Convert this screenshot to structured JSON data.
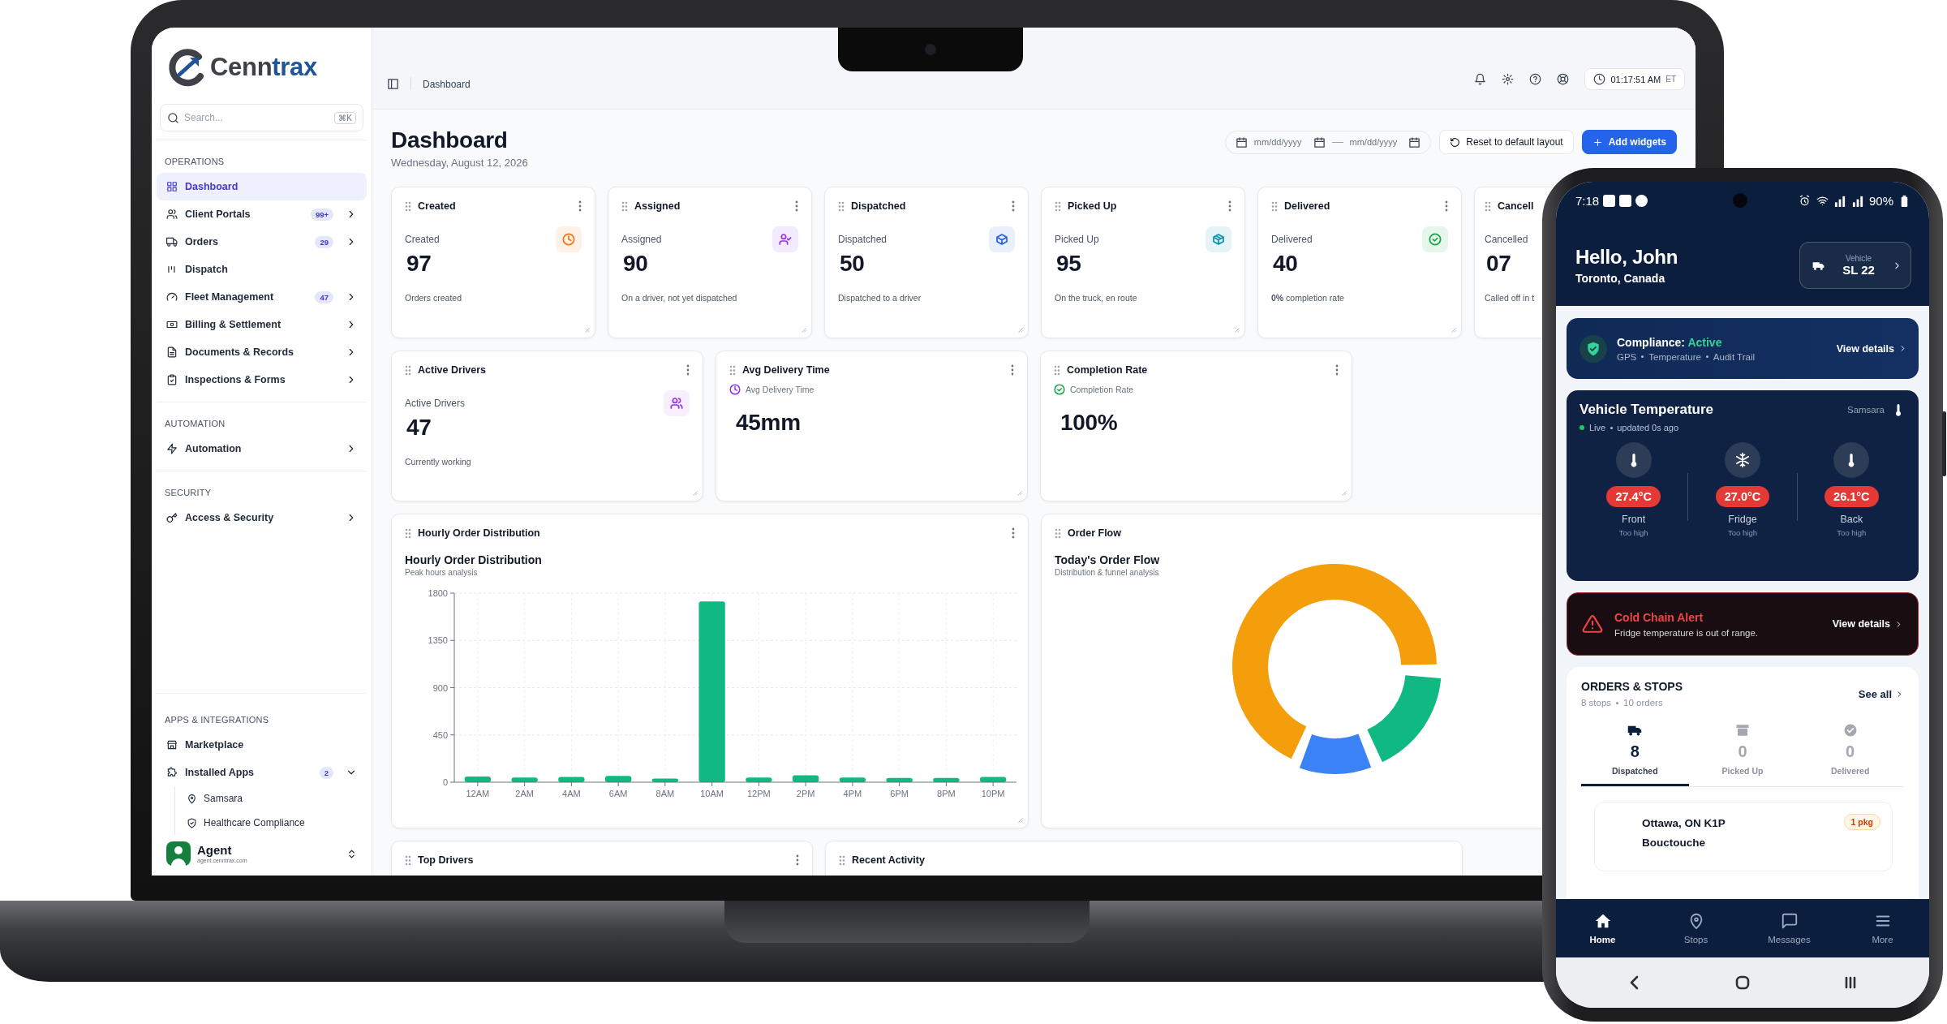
{
  "laptop": {
    "sidebar": {
      "brand": {
        "name": "Cenn",
        "accent": "trax"
      },
      "search": {
        "placeholder": "Search...",
        "shortcut": "⌘K"
      },
      "sections": [
        {
          "title": "OPERATIONS",
          "items": [
            {
              "label": "Dashboard",
              "selected": true,
              "submenu": false
            },
            {
              "label": "Client Portals",
              "badge": "99+",
              "selected": false,
              "submenu": true
            },
            {
              "label": "Orders",
              "badge": "29",
              "selected": false,
              "submenu": true
            },
            {
              "label": "Dispatch",
              "selected": false,
              "submenu": false
            },
            {
              "label": "Fleet Management",
              "badge": "47",
              "selected": false,
              "submenu": true
            },
            {
              "label": "Billing & Settlement",
              "selected": false,
              "submenu": true
            },
            {
              "label": "Documents & Records",
              "selected": false,
              "submenu": true
            },
            {
              "label": "Inspections & Forms",
              "selected": false,
              "submenu": true
            }
          ]
        },
        {
          "title": "AUTOMATION",
          "items": [
            {
              "label": "Automation",
              "selected": false,
              "submenu": true
            }
          ]
        },
        {
          "title": "SECURITY",
          "items": [
            {
              "label": "Access & Security",
              "selected": false,
              "submenu": true
            }
          ]
        }
      ],
      "apps": {
        "title": "APPS & INTEGRATIONS",
        "items": [
          {
            "label": "Marketplace",
            "selected": false,
            "submenu": false
          },
          {
            "label": "Installed Apps",
            "badge": "2",
            "selected": false,
            "submenu": true,
            "expanded": true,
            "children": [
              {
                "label": "Samsara"
              },
              {
                "label": "Healthcare Compliance"
              }
            ]
          }
        ]
      },
      "user": {
        "name": "Agent",
        "email": "agent.cenntrax.com"
      }
    },
    "topbar": {
      "breadcrumb": "Dashboard",
      "clock": "01:17:51 AM",
      "timezone": "ET"
    },
    "page": {
      "title": "Dashboard",
      "date": "Wednesday, August 12, 2026",
      "date_from": {
        "placeholder": "mm/dd/yyyy"
      },
      "date_to": {
        "placeholder": "mm/dd/yyyy"
      },
      "buttons": [
        {
          "label": "Reset to default layout",
          "kind": "secondary"
        },
        {
          "label": "Add widgets",
          "kind": "primary"
        }
      ]
    },
    "stat_cards": [
      {
        "title": "Created",
        "label": "Created",
        "value": "97",
        "caption": "Orders created",
        "color": "#f97316"
      },
      {
        "title": "Assigned",
        "label": "Assigned",
        "value": "90",
        "caption": "On a driver, not yet dispatched",
        "color": "#9333ea"
      },
      {
        "title": "Dispatched",
        "label": "Dispatched",
        "value": "50",
        "caption": "Dispatched to a driver",
        "color": "#2563eb"
      },
      {
        "title": "Picked Up",
        "label": "Picked Up",
        "value": "95",
        "caption": "On the truck, en route",
        "color": "#0891b2"
      },
      {
        "title": "Delivered",
        "label": "Delivered",
        "value": "40",
        "caption": "**0%** completion rate",
        "color": "#16a34a"
      },
      {
        "title": "Cancell",
        "label": "Cancelled",
        "value": "07",
        "caption": "Called off in t"
      }
    ],
    "metric_cards": [
      {
        "title": "Active Drivers",
        "label": "Active Drivers",
        "value": "47",
        "caption": "Currently working",
        "kind": "badge",
        "color": "#9333ea"
      },
      {
        "title": "Avg Delivery Time",
        "label": "Avg Delivery Time",
        "value": "45mm",
        "kind": "inline",
        "color": "#9333ea"
      },
      {
        "title": "Completion Rate",
        "label": "Completion Rate",
        "value": "100%",
        "kind": "inline",
        "color": "#16a34a"
      }
    ],
    "widgets": {
      "hourly": {
        "title": "Hourly Order Distribution",
        "heading": "Hourly Order Distribution",
        "subtitle": "Peak hours analysis",
        "chart_data": {
          "type": "bar",
          "categories": [
            "12AM",
            "2AM",
            "4AM",
            "6AM",
            "8AM",
            "10AM",
            "12PM",
            "2PM",
            "4PM",
            "6PM",
            "8PM",
            "10PM"
          ],
          "values": [
            55,
            45,
            50,
            60,
            35,
            1720,
            45,
            65,
            45,
            40,
            40,
            50
          ],
          "ylim": [
            0,
            1800
          ],
          "yticks": [
            0,
            450,
            900,
            1350,
            1800
          ],
          "grid": true
        }
      },
      "flow": {
        "title": "Order Flow",
        "heading": "Today's Order Flow",
        "subtitle": "Distribution & funnel analysis"
      },
      "more": [
        {
          "title": "Top Drivers"
        },
        {
          "title": "Recent Activity"
        }
      ]
    }
  },
  "phone": {
    "status_bar": {
      "time": "7:18",
      "battery": "90%"
    },
    "greeting": "Hello, John",
    "location": "Toronto, Canada",
    "vehicle": {
      "label": "Vehicle",
      "value": "SL 22"
    },
    "compliance": {
      "title": "Compliance:",
      "status": "Active",
      "features": [
        "GPS",
        "Temperature",
        "Audit Trail"
      ],
      "link": "View details"
    },
    "temperature": {
      "title": "Vehicle Temperature",
      "source": "Samsara",
      "live": "Live",
      "updated": "updated 0s ago",
      "zones": [
        {
          "kind": "thermometer",
          "reading": "27.4°C",
          "name": "Front",
          "status": "Too high"
        },
        {
          "kind": "snowflake",
          "reading": "27.0°C",
          "name": "Fridge",
          "status": "Too high"
        },
        {
          "kind": "thermometer",
          "reading": "26.1°C",
          "name": "Back",
          "status": "Too high"
        }
      ]
    },
    "alert": {
      "title": "Cold Chain Alert",
      "message": "Fridge temperature is out of range.",
      "link": "View details"
    },
    "orders": {
      "title": "ORDERS & STOPS",
      "stops": "8 stops",
      "orders": "10 orders",
      "link": "See all",
      "tabs": [
        {
          "count": "8",
          "label": "Dispatched",
          "selected": true
        },
        {
          "count": "0",
          "label": "Picked Up",
          "selected": false
        },
        {
          "count": "0",
          "label": "Delivered",
          "selected": false
        }
      ],
      "stop": {
        "address": "Ottawa, ON K1P",
        "city": "Bouctouche",
        "badge": "1 pkg"
      }
    },
    "nav": [
      {
        "label": "Home",
        "selected": true
      },
      {
        "label": "Stops",
        "selected": false
      },
      {
        "label": "Messages",
        "selected": false
      },
      {
        "label": "More",
        "selected": false
      }
    ]
  }
}
